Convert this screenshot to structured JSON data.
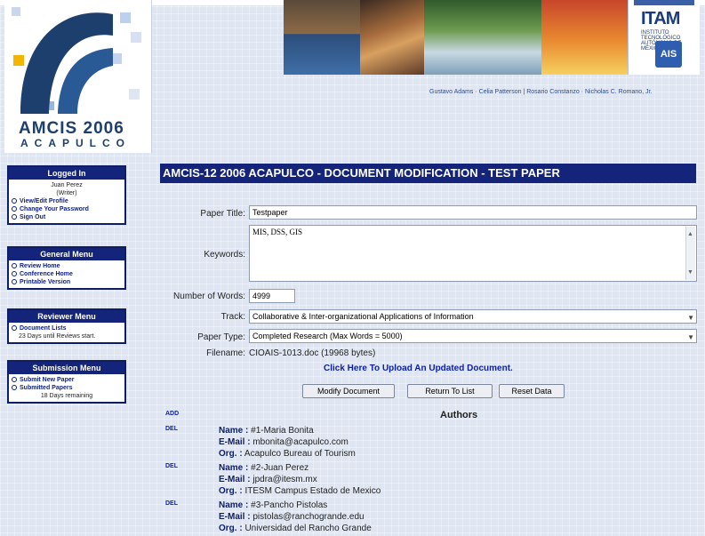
{
  "header": {
    "logo_year": "AMCIS 2006",
    "logo_city": "ACAPULCO",
    "sponsor": "ITAM",
    "sponsor_sub": "INSTITUTO TECNOLÓGICO AUTÓNOMO DE MÉXICO",
    "ais_mark": "AIS",
    "credits": "Gustavo Adams · Celia Patterson | Rosario Constanzo · Nicholas C. Romano, Jr."
  },
  "sidebar": {
    "logged_in": {
      "title": "Logged In",
      "name": "Juan Perez",
      "role": "(Writer)",
      "items": [
        "View/Edit Profile",
        "Change Your Password",
        "Sign Out"
      ]
    },
    "general": {
      "title": "General Menu",
      "items": [
        "Review Home",
        "Conference Home",
        "Printable Version"
      ]
    },
    "reviewer": {
      "title": "Reviewer Menu",
      "items": [
        "Document Lists"
      ],
      "note": "23 Days until Reviews start."
    },
    "submission": {
      "title": "Submission Menu",
      "items": [
        "Submit New Paper",
        "Submitted Papers"
      ],
      "note": "18 Days remaining"
    }
  },
  "main": {
    "title": "AMCIS-12 2006 ACAPULCO - DOCUMENT MODIFICATION - TEST PAPER",
    "paper_title_label": "Paper Title:",
    "paper_title_value": "Testpaper",
    "keywords_label": "Keywords:",
    "keywords_value": "MIS, DSS, GIS",
    "words_label": "Number of Words:",
    "words_value": "4999",
    "track_label": "Track:",
    "track_value": "Collaborative & Inter-organizational Applications of Information",
    "type_label": "Paper Type:",
    "type_value": "Completed Research (Max Words = 5000)",
    "filename_label": "Filename:",
    "filename_value": "CIOAIS-1013.doc (19968 bytes)",
    "upload_link": "Click Here To Upload An Updated Document.",
    "buttons": {
      "modify": "Modify Document",
      "return": "Return To List",
      "reset": "Reset Data"
    },
    "add_label": "ADD",
    "authors_heading": "Authors",
    "del_label": "DEL",
    "name_key": "Name :",
    "email_key": "E-Mail :",
    "org_key": "Org. :",
    "authors": [
      {
        "name": "#1-Maria Bonita",
        "email": "mbonita@acapulco.com",
        "org": "Acapulco Bureau of Tourism"
      },
      {
        "name": "#2-Juan Perez",
        "email": "jpdra@itesm.mx",
        "org": "ITESM Campus Estado de Mexico"
      },
      {
        "name": "#3-Pancho Pistolas",
        "email": "pistolas@ranchogrande.edu",
        "org": "Universidad del Rancho Grande"
      }
    ]
  }
}
